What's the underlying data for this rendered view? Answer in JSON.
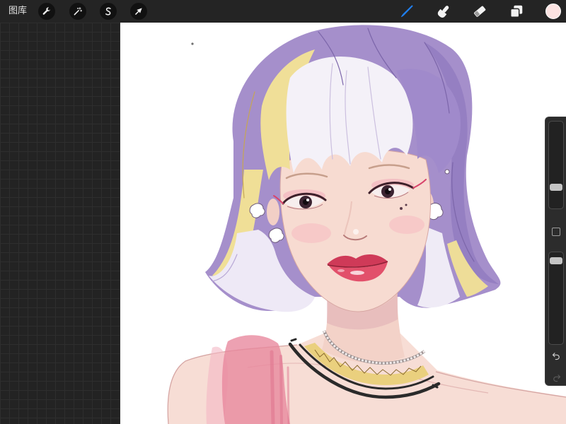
{
  "toolbar": {
    "gallery_label": "图库",
    "left_icons": [
      "wrench-icon",
      "magic-wand-icon",
      "selection-icon",
      "transform-arrow-icon"
    ],
    "right_icons": [
      "brush-icon",
      "smudge-icon",
      "eraser-icon",
      "layers-icon"
    ],
    "active_tool_icon": "brush-icon",
    "current_color": "#fce3e2"
  },
  "sidebar": {
    "brush_size_level": 0.22,
    "opacity_level": 0.95,
    "icons": [
      "modify-square-icon",
      "undo-icon",
      "redo-icon"
    ],
    "redo_enabled": false
  },
  "colors": {
    "active_tool": "#1f7ff2",
    "icon": "#f2f2f2",
    "toolbar_bg": "#242424",
    "workspace_bg": "#232323",
    "canvas_bg": "#ffffff"
  }
}
